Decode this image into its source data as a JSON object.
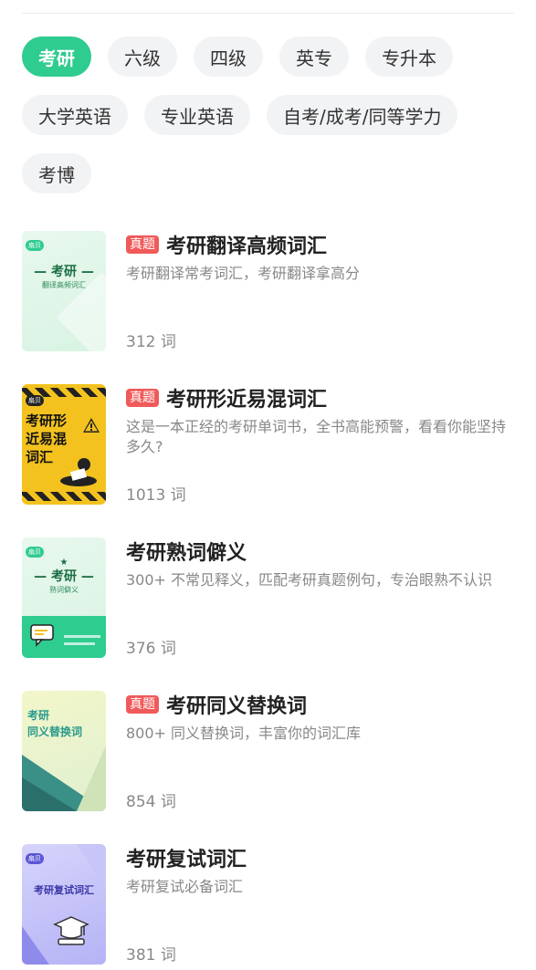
{
  "categories": {
    "row1": [
      "考研",
      "六级",
      "四级",
      "英专",
      "专升本"
    ],
    "row2": [
      "大学英语",
      "专业英语",
      "自考/成考/同等学力"
    ],
    "row3": [
      "考博"
    ]
  },
  "books": [
    {
      "tag": "真题",
      "title": "考研翻译高频词汇",
      "desc": "考研翻译常考词汇，考研翻译拿高分",
      "count": "312 词",
      "cover": {
        "brand": "扇贝",
        "main": "— 考研 —",
        "sub": "翻译高频词汇"
      }
    },
    {
      "tag": "真题",
      "title": "考研形近易混词汇",
      "desc": "这是一本正经的考研单词书，全书高能预警，看看你能坚持多久?",
      "count": "1013 词",
      "cover": {
        "brand": "扇贝",
        "main": "考研形近易混词汇"
      }
    },
    {
      "tag": "",
      "title": "考研熟词僻义",
      "desc": "300+ 不常见释义，匹配考研真题例句，专治眼熟不认识",
      "count": "376 词",
      "cover": {
        "brand": "扇贝",
        "main": "— 考研 —",
        "sub": "熟词僻义"
      }
    },
    {
      "tag": "真题",
      "title": "考研同义替换词",
      "desc": "800+ 同义替换词，丰富你的词汇库",
      "count": "854 词",
      "cover": {
        "main": "考研",
        "sub": "同义替换词"
      }
    },
    {
      "tag": "",
      "title": "考研复试词汇",
      "desc": "考研复试必备词汇",
      "count": "381 词",
      "cover": {
        "brand": "扇贝",
        "main": "考研复试词汇"
      }
    }
  ]
}
